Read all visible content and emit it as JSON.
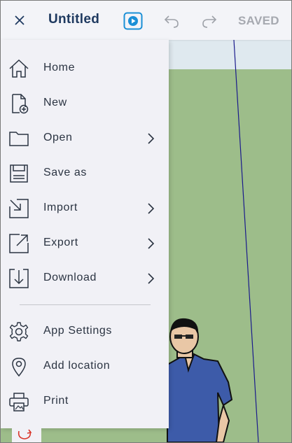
{
  "app": {
    "title": "Untitled",
    "save_status": "SAVED"
  },
  "toolbar": {
    "close_icon": "close-icon",
    "play_icon": "play-icon",
    "undo_icon": "undo-icon",
    "redo_icon": "redo-icon",
    "accent_color": "#1a8fd6"
  },
  "menu": {
    "items": [
      {
        "label": "Home",
        "icon": "home-icon",
        "has_submenu": false
      },
      {
        "label": "New",
        "icon": "new-file-icon",
        "has_submenu": false
      },
      {
        "label": "Open",
        "icon": "folder-icon",
        "has_submenu": true
      },
      {
        "label": "Save as",
        "icon": "save-icon",
        "has_submenu": false
      },
      {
        "label": "Import",
        "icon": "import-icon",
        "has_submenu": true
      },
      {
        "label": "Export",
        "icon": "export-icon",
        "has_submenu": true
      },
      {
        "label": "Download",
        "icon": "download-icon",
        "has_submenu": true
      }
    ],
    "secondary_items": [
      {
        "label": "App Settings",
        "icon": "gear-icon"
      },
      {
        "label": "Add location",
        "icon": "location-pin-icon"
      },
      {
        "label": "Print",
        "icon": "printer-icon"
      }
    ]
  },
  "colors": {
    "title": "#1f3a60",
    "ground": "#9dbd8a",
    "sky": "#dfe9ef",
    "axis": "#1a1a8c"
  }
}
